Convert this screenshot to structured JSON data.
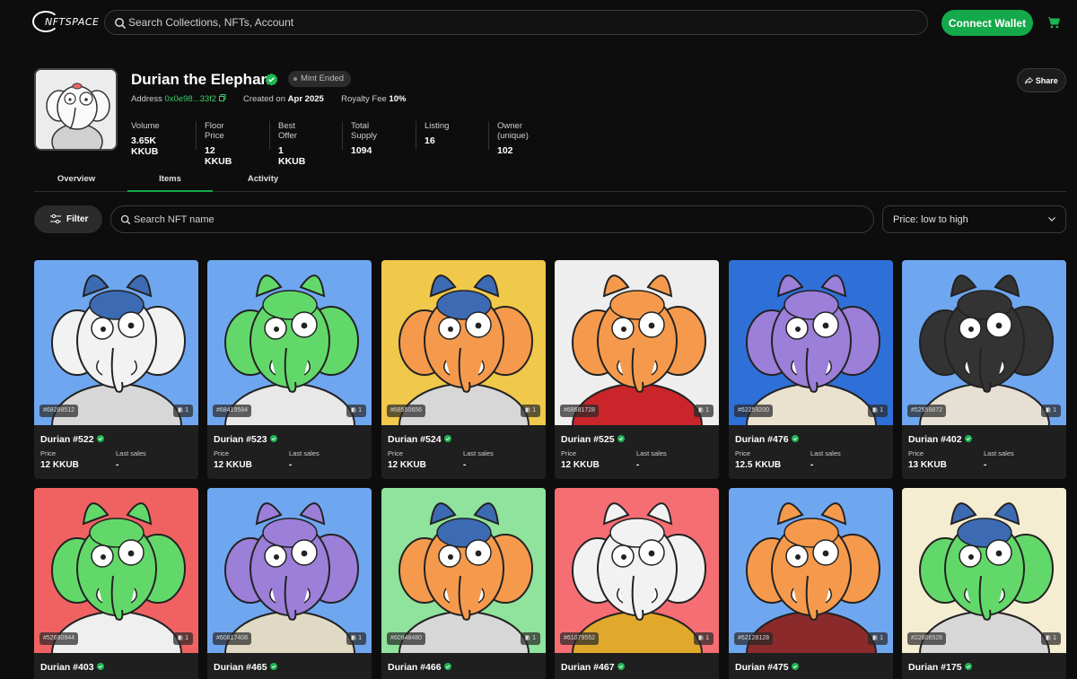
{
  "nav": {
    "logo_text": "NFTSPACE",
    "search_placeholder": "Search Collections, NFTs, Account",
    "connect_wallet": "Connect Wallet",
    "cart_icon": "cart-icon"
  },
  "collection": {
    "name": "Durian the Elephant",
    "status": "Mint Ended",
    "address_label": "Address",
    "address": "0x0e98...33f2",
    "created_label": "Created on",
    "created": "Apr 2025",
    "royalty_label": "Royalty Fee",
    "royalty": "10%",
    "share": "Share",
    "stats": [
      {
        "label": "Volume",
        "value": "3.65K KKUB"
      },
      {
        "label": "Floor Price",
        "value": "12 KKUB"
      },
      {
        "label": "Best Offer",
        "value": "1 KKUB"
      },
      {
        "label": "Total Supply",
        "value": "1094"
      },
      {
        "label": "Listing",
        "value": "16"
      },
      {
        "label": "Owner (unique)",
        "value": "102"
      }
    ]
  },
  "tabs": [
    {
      "label": "Overview",
      "active": false
    },
    {
      "label": "Items",
      "active": true
    },
    {
      "label": "Activity",
      "active": false
    }
  ],
  "toolbar": {
    "filter": "Filter",
    "search_placeholder": "Search NFT name",
    "sort": "Price: low to high"
  },
  "card_labels": {
    "price": "Price",
    "last_sales": "Last sales"
  },
  "items": [
    {
      "name": "Durian #522",
      "id": "#68288512",
      "count": "1",
      "price": "12 KKUB",
      "last": "-",
      "bg": "#6fa6f0",
      "skin": "#f2f2f2",
      "head": "#3d6bb3",
      "body": "#d7d7d7"
    },
    {
      "name": "Durian #523",
      "id": "#68419584",
      "count": "1",
      "price": "12 KKUB",
      "last": "-",
      "bg": "#6fa6f0",
      "skin": "#63d86a",
      "head": "#63d86a",
      "body": "#e8e8e8"
    },
    {
      "name": "Durian #524",
      "id": "#68550656",
      "count": "1",
      "price": "12 KKUB",
      "last": "-",
      "bg": "#f0c84a",
      "skin": "#f59a4c",
      "head": "#3d6bb3",
      "body": "#d7d7d7"
    },
    {
      "name": "Durian #525",
      "id": "#68681728",
      "count": "1",
      "price": "12 KKUB",
      "last": "-",
      "bg": "#eeeeee",
      "skin": "#f59a4c",
      "head": "#f59a4c",
      "body": "#c9252b"
    },
    {
      "name": "Durian #476",
      "id": "#62259200",
      "count": "1",
      "price": "12.5 KKUB",
      "last": "-",
      "bg": "#2f6fd8",
      "skin": "#9b7fd8",
      "head": "#9b7fd8",
      "body": "#eae2cf"
    },
    {
      "name": "Durian #402",
      "id": "#52559872",
      "count": "1",
      "price": "13 KKUB",
      "last": "-",
      "bg": "#6fa6f0",
      "skin": "#333333",
      "head": "#333333",
      "body": "#e6e0d4"
    },
    {
      "name": "Durian #403",
      "id": "#52690944",
      "count": "1",
      "price": "",
      "last": "",
      "bg": "#f06262",
      "skin": "#63d86a",
      "head": "#63d86a",
      "body": "#efefef"
    },
    {
      "name": "Durian #465",
      "id": "#60817408",
      "count": "1",
      "price": "",
      "last": "",
      "bg": "#6fa6f0",
      "skin": "#9b7fd8",
      "head": "#9b7fd8",
      "body": "#e0dac4"
    },
    {
      "name": "Durian #466",
      "id": "#60948480",
      "count": "1",
      "price": "",
      "last": "",
      "bg": "#8fe39c",
      "skin": "#f59a4c",
      "head": "#3d6bb3",
      "body": "#d7d7d7"
    },
    {
      "name": "Durian #467",
      "id": "#61079552",
      "count": "1",
      "price": "",
      "last": "",
      "bg": "#f56e74",
      "skin": "#f2f2f2",
      "head": "#f2f2f2",
      "body": "#e0a92c"
    },
    {
      "name": "Durian #475",
      "id": "#62128128",
      "count": "1",
      "price": "",
      "last": "",
      "bg": "#6fa6f0",
      "skin": "#f59a4c",
      "head": "#f59a4c",
      "body": "#8a2a2a"
    },
    {
      "name": "Durian #175",
      "id": "#22806528",
      "count": "1",
      "price": "",
      "last": "",
      "bg": "#f4edd2",
      "skin": "#63d86a",
      "head": "#3d6bb3",
      "body": "#d7d7d7"
    }
  ]
}
